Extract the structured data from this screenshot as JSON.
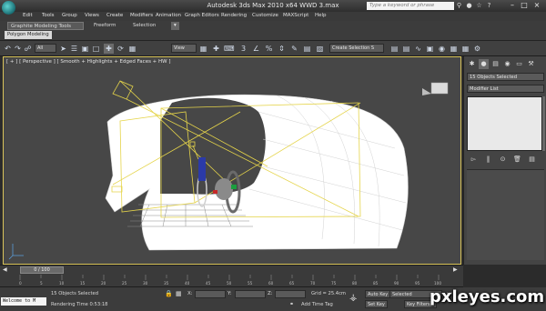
{
  "title_bar": {
    "title": "Autodesk 3ds Max  2010 x64      WWD 3.max",
    "search_placeholder": "Type a keyword or phrase"
  },
  "menu": [
    "Edit",
    "Tools",
    "Group",
    "Views",
    "Create",
    "Modifiers",
    "Animation",
    "Graph Editors",
    "Rendering",
    "Customize",
    "MAXScript",
    "Help"
  ],
  "ribbon": {
    "tabs": [
      "Graphite Modeling Tools",
      "Freeform",
      "Selection"
    ],
    "subtab": "Polygon Modeling"
  },
  "toolbar": {
    "filter_value": "All",
    "reference_coord": "View",
    "named_selection": "Create Selection S"
  },
  "viewport": {
    "label": "[ + ] [ Perspective ] [ Smooth + Highlights + Edged Faces + HW ]"
  },
  "command_panel": {
    "selection_field": "15 Objects Selected",
    "modifier_list": "Modifier List"
  },
  "time_slider": {
    "frame": "0 / 100"
  },
  "timeline_ticks": [
    "0",
    "5",
    "10",
    "15",
    "20",
    "25",
    "30",
    "35",
    "40",
    "45",
    "50",
    "55",
    "60",
    "65",
    "70",
    "75",
    "80",
    "85",
    "90",
    "95",
    "100"
  ],
  "status": {
    "maxscript": "Welcome to M",
    "objects_selected": "15 Objects Selected",
    "rendering_time": "Rendering Time  0:53:18",
    "x_label": "X:",
    "y_label": "Y:",
    "z_label": "Z:",
    "grid": "Grid = 25.4cm",
    "add_time_tag": "Add Time Tag",
    "auto_key": "Auto Key",
    "set_key": "Set Key",
    "selected": "Selected",
    "key_filters": "Key Filters..."
  },
  "watermark": "pxleyes.com"
}
